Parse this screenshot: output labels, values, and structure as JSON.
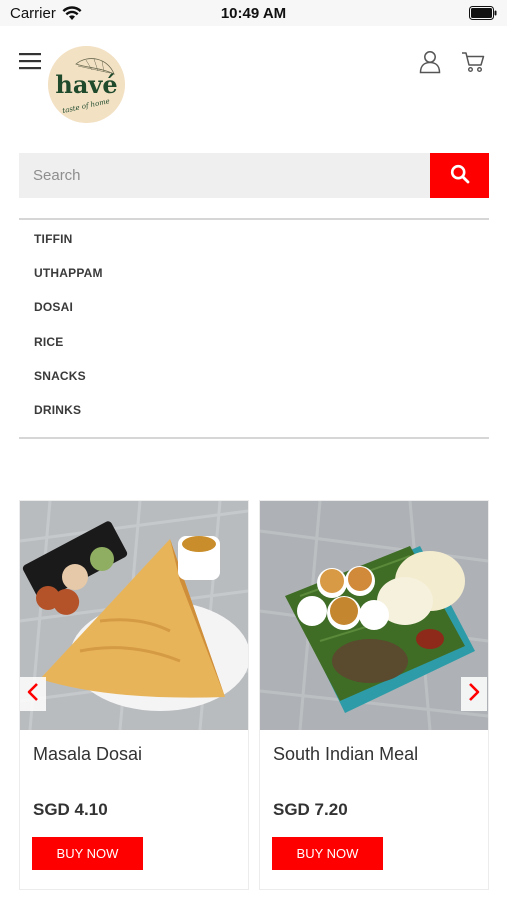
{
  "status_bar": {
    "carrier": "Carrier",
    "time": "10:49 AM"
  },
  "header": {
    "logo_text": "havé",
    "logo_tagline": "taste of home"
  },
  "search": {
    "placeholder": "Search"
  },
  "categories": [
    {
      "label": "TIFFIN"
    },
    {
      "label": "UTHAPPAM"
    },
    {
      "label": "DOSAI"
    },
    {
      "label": "RICE"
    },
    {
      "label": "SNACKS"
    },
    {
      "label": "DRINKS"
    }
  ],
  "products": [
    {
      "name": "Masala Dosai",
      "price": "SGD 4.10",
      "button": "BUY NOW"
    },
    {
      "name": "South Indian Meal",
      "price": "SGD 7.20",
      "button": "BUY NOW"
    }
  ],
  "colors": {
    "accent": "#ff0000",
    "search_bg": "#efefef",
    "logo_bg": "#f3e1c4"
  },
  "icons": [
    "wifi-icon",
    "battery-icon",
    "menu-icon",
    "user-icon",
    "cart-icon",
    "search-icon",
    "chevron-left-icon",
    "chevron-right-icon"
  ]
}
